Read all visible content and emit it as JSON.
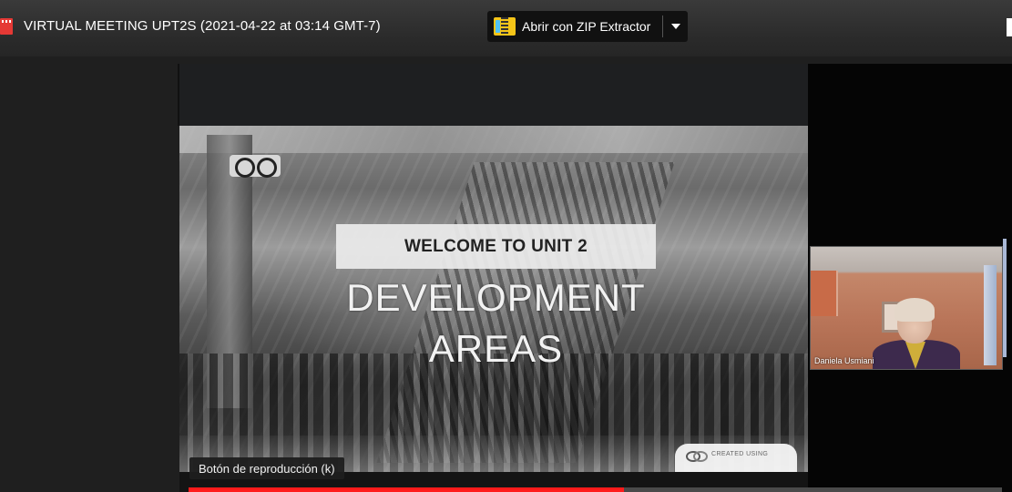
{
  "header": {
    "file_title": "VIRTUAL MEETING UPT2S (2021-04-22 at 03:14 GMT-7)",
    "file_icon": "video-file-icon",
    "open_with_label": "Abrir con ZIP Extractor",
    "open_with_icon": "zip-extractor-icon",
    "dropdown_icon": "chevron-down-icon"
  },
  "slide": {
    "welcome": "WELCOME TO UNIT 2",
    "title_line1": "DEVELOPMENT",
    "title_line2": "AREAS",
    "badge_text": "CREATED USING"
  },
  "participant": {
    "name": "Daniela Usmiani"
  },
  "player": {
    "tooltip": "Botón de reproducción (k)",
    "progress": 0.535
  },
  "colors": {
    "progress": "#ff1b1b",
    "topbar": "#2a2a2a",
    "background": "#1f1f1f"
  }
}
